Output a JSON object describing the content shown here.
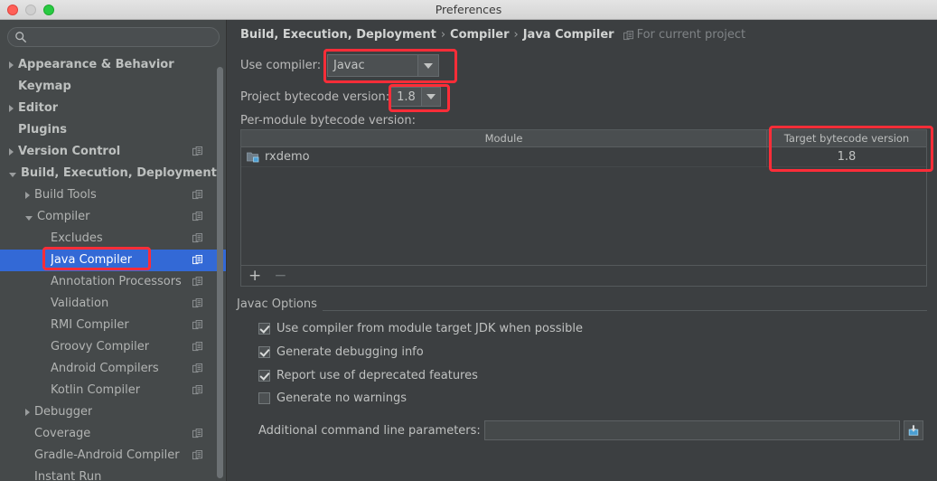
{
  "window": {
    "title": "Preferences",
    "controls": [
      "close-button",
      "minimize-button",
      "zoom-button"
    ]
  },
  "sidebar": {
    "search": {
      "value": "",
      "placeholder": "",
      "icon": "search-icon"
    },
    "items": [
      {
        "label": "Appearance & Behavior",
        "indent": 0,
        "arrow": "right",
        "bold": true,
        "badge": false,
        "selected": false
      },
      {
        "label": "Keymap",
        "indent": 0,
        "arrow": "none",
        "bold": true,
        "badge": false,
        "selected": false
      },
      {
        "label": "Editor",
        "indent": 0,
        "arrow": "right",
        "bold": true,
        "badge": false,
        "selected": false
      },
      {
        "label": "Plugins",
        "indent": 0,
        "arrow": "none",
        "bold": true,
        "badge": false,
        "selected": false
      },
      {
        "label": "Version Control",
        "indent": 0,
        "arrow": "right",
        "bold": true,
        "badge": true,
        "selected": false
      },
      {
        "label": "Build, Execution, Deployment",
        "indent": 0,
        "arrow": "down",
        "bold": true,
        "badge": false,
        "selected": false
      },
      {
        "label": "Build Tools",
        "indent": 1,
        "arrow": "right",
        "bold": false,
        "badge": true,
        "selected": false
      },
      {
        "label": "Compiler",
        "indent": 1,
        "arrow": "down",
        "bold": false,
        "badge": true,
        "selected": false
      },
      {
        "label": "Excludes",
        "indent": 2,
        "arrow": "none",
        "bold": false,
        "badge": true,
        "selected": false
      },
      {
        "label": "Java Compiler",
        "indent": 2,
        "arrow": "none",
        "bold": false,
        "badge": true,
        "selected": true
      },
      {
        "label": "Annotation Processors",
        "indent": 2,
        "arrow": "none",
        "bold": false,
        "badge": true,
        "selected": false
      },
      {
        "label": "Validation",
        "indent": 2,
        "arrow": "none",
        "bold": false,
        "badge": true,
        "selected": false
      },
      {
        "label": "RMI Compiler",
        "indent": 2,
        "arrow": "none",
        "bold": false,
        "badge": true,
        "selected": false
      },
      {
        "label": "Groovy Compiler",
        "indent": 2,
        "arrow": "none",
        "bold": false,
        "badge": true,
        "selected": false
      },
      {
        "label": "Android Compilers",
        "indent": 2,
        "arrow": "none",
        "bold": false,
        "badge": true,
        "selected": false
      },
      {
        "label": "Kotlin Compiler",
        "indent": 2,
        "arrow": "none",
        "bold": false,
        "badge": true,
        "selected": false
      },
      {
        "label": "Debugger",
        "indent": 1,
        "arrow": "right",
        "bold": false,
        "badge": false,
        "selected": false
      },
      {
        "label": "Coverage",
        "indent": 1,
        "arrow": "none",
        "bold": false,
        "badge": true,
        "selected": false
      },
      {
        "label": "Gradle-Android Compiler",
        "indent": 1,
        "arrow": "none",
        "bold": false,
        "badge": true,
        "selected": false
      },
      {
        "label": "Instant Run",
        "indent": 1,
        "arrow": "none",
        "bold": false,
        "badge": false,
        "selected": false
      }
    ]
  },
  "main": {
    "breadcrumb": {
      "parts": [
        "Build, Execution, Deployment",
        "Compiler",
        "Java Compiler"
      ],
      "separator": "›",
      "scope_note": "For current project",
      "scope_icon": "project-settings-icon"
    },
    "use_compiler": {
      "label": "Use compiler:",
      "value": "Javac",
      "caret_icon": "chevron-down-icon"
    },
    "project_bytecode": {
      "label": "Project bytecode version:",
      "value": "1.8",
      "caret_icon": "chevron-down-icon"
    },
    "per_module": {
      "label": "Per-module bytecode version:",
      "columns": [
        "Module",
        "Target bytecode version"
      ],
      "rows": [
        {
          "module": "rxdemo",
          "module_icon": "module-folder-icon",
          "target": "1.8"
        }
      ],
      "toolbar": {
        "add": "+",
        "remove": "−"
      }
    },
    "javac_options": {
      "title": "Javac Options",
      "options": [
        {
          "label": "Use compiler from module target JDK when possible",
          "checked": true
        },
        {
          "label": "Generate debugging info",
          "checked": true
        },
        {
          "label": "Report use of deprecated features",
          "checked": true
        },
        {
          "label": "Generate no warnings",
          "checked": false
        }
      ],
      "params": {
        "label": "Additional command line parameters:",
        "value": "",
        "placeholder": "",
        "browse_icon": "expand-editor-icon"
      }
    }
  },
  "annotations": {
    "color": "#ff2d38",
    "boxes": [
      "use-compiler-combo-highlight",
      "project-bytecode-combo-highlight",
      "target-bytecode-column-highlight",
      "java-compiler-sidebar-highlight"
    ]
  }
}
